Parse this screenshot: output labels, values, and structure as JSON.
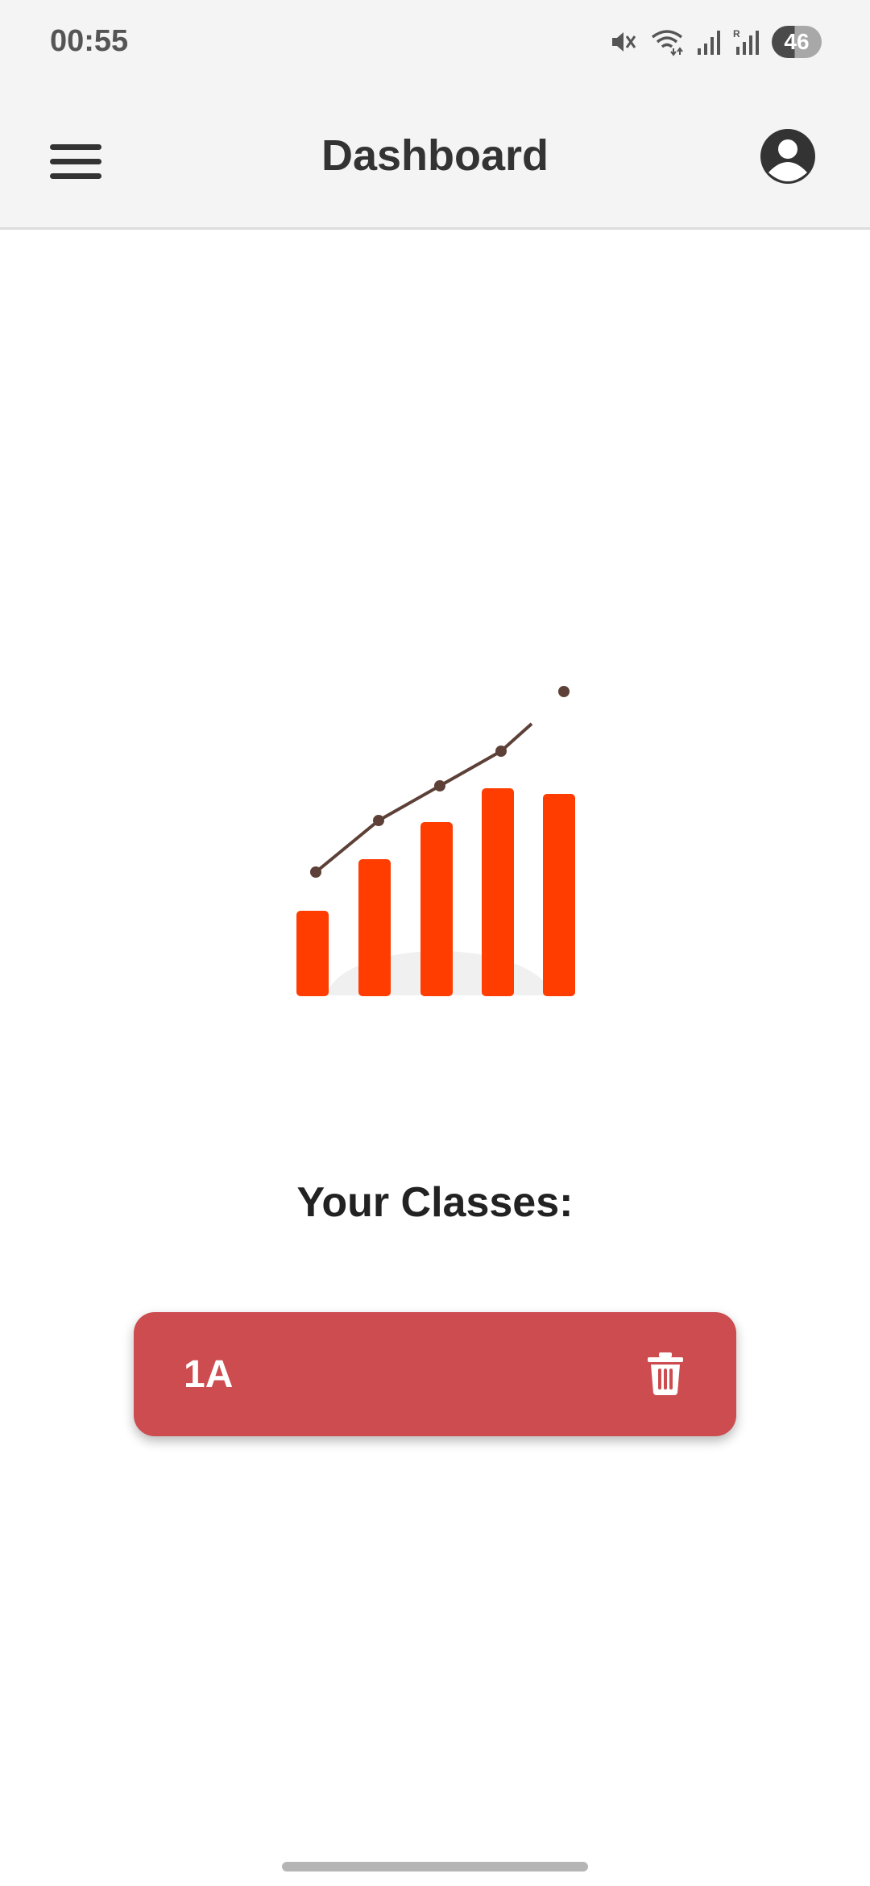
{
  "status_bar": {
    "time": "00:55",
    "battery_level": "46",
    "icons": [
      "mute-icon",
      "wifi-icon",
      "signal-icon",
      "signal-roaming-icon",
      "battery-icon"
    ]
  },
  "app_bar": {
    "title": "Dashboard",
    "menu_icon": "hamburger-menu-icon",
    "account_icon": "account-circle-icon"
  },
  "illustration": {
    "icon": "growth-chart-illustration",
    "bar_color": "#ff3d00",
    "line_color": "#5d4037"
  },
  "classes_section": {
    "title": "Your Classes:",
    "items": [
      {
        "name": "1A",
        "delete_icon": "trash-icon"
      }
    ]
  },
  "colors": {
    "card": "#cc4c50",
    "header_bg": "#f4f4f4"
  }
}
